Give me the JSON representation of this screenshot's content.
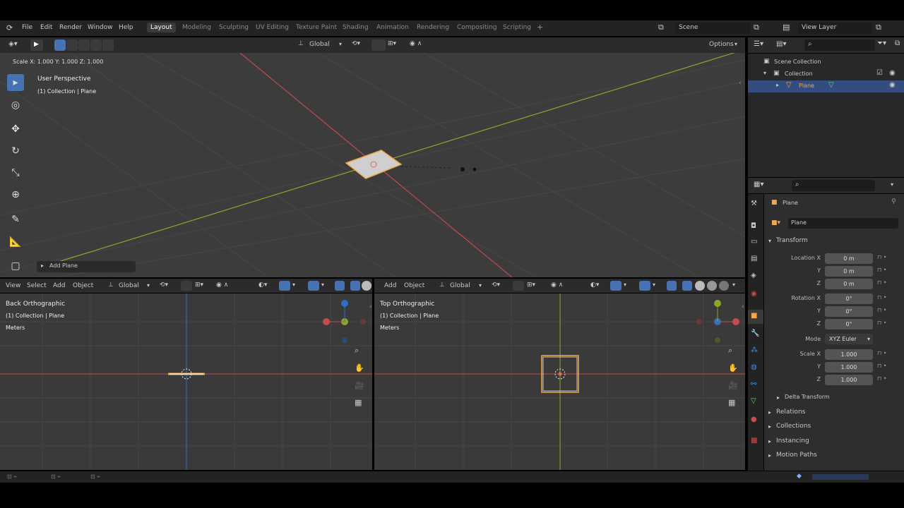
{
  "menu": {
    "file": "File",
    "edit": "Edit",
    "render": "Render",
    "window": "Window",
    "help": "Help"
  },
  "workspaces": [
    "Layout",
    "Modeling",
    "Sculpting",
    "UV Editing",
    "Texture Paint",
    "Shading",
    "Animation",
    "Rendering",
    "Compositing",
    "Scripting"
  ],
  "scene": {
    "label": "Scene",
    "view_layer": "View Layer"
  },
  "viewport_top": {
    "transform_orientation": "Global",
    "options": "Options",
    "operator_readout": "Scale X: 1.000  Y: 1.000  Z: 1.000",
    "view_name": "User Perspective",
    "collection_path": "(1) Collection | Plane",
    "last_op": "Add Plane"
  },
  "viewport_back": {
    "menu": [
      "View",
      "Select",
      "Add",
      "Object"
    ],
    "orientation": "Global",
    "view_name": "Back Orthographic",
    "collection_path": "(1) Collection | Plane",
    "units": "Meters"
  },
  "viewport_topo": {
    "menu": [
      "Add",
      "Object"
    ],
    "orientation": "Global",
    "view_name": "Top Orthographic",
    "collection_path": "(1) Collection | Plane",
    "units": "Meters"
  },
  "outliner": {
    "scene_collection": "Scene Collection",
    "collection": "Collection",
    "object": "Plane"
  },
  "properties": {
    "object_name": "Plane",
    "object_data_name": "Plane",
    "transform_header": "Transform",
    "location_label": "Location X",
    "y_label": "Y",
    "z_label": "Z",
    "location": [
      "0 m",
      "0 m",
      "0 m"
    ],
    "rotation_label": "Rotation X",
    "rotation": [
      "0°",
      "0°",
      "0°"
    ],
    "mode_label": "Mode",
    "mode_value": "XYZ Euler",
    "scale_label": "Scale X",
    "scale": [
      "1.000",
      "1.000",
      "1.000"
    ],
    "delta_transform": "Delta Transform",
    "sections": [
      "Relations",
      "Collections",
      "Instancing",
      "Motion Paths"
    ]
  },
  "colors": {
    "x_axis": "#c24b4b",
    "y_axis": "#8aa82a",
    "z_axis": "#2f6fc4",
    "selected": "#4772b3",
    "object_outline": "#f5a844"
  }
}
